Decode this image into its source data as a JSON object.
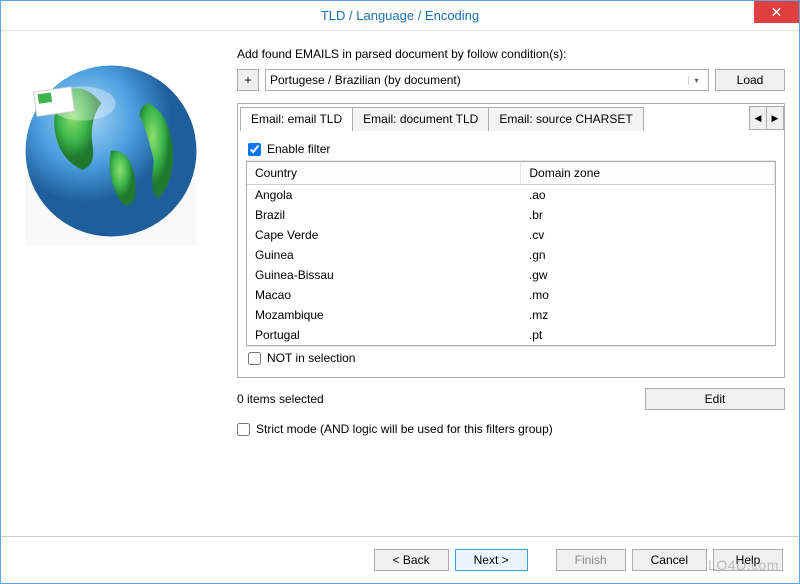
{
  "window": {
    "title": "TLD / Language / Encoding",
    "close": "✕"
  },
  "intro": "Add found EMAILS in parsed document by follow condition(s):",
  "dropdown": {
    "selected": "Portugese / Brazilian (by document)"
  },
  "buttons": {
    "plus": "+",
    "load": "Load",
    "edit": "Edit",
    "back": "< Back",
    "next": "Next >",
    "finish": "Finish",
    "cancel": "Cancel",
    "help": "Help"
  },
  "tabs": [
    {
      "label": "Email: email TLD",
      "active": true
    },
    {
      "label": "Email: document TLD",
      "active": false
    },
    {
      "label": "Email: source CHARSET",
      "active": false
    }
  ],
  "tab_arrows": {
    "left": "◀",
    "right": "▶"
  },
  "enable_filter": {
    "label": "Enable filter",
    "checked": true
  },
  "table": {
    "headers": {
      "country": "Country",
      "zone": "Domain zone"
    },
    "rows": [
      {
        "country": "Angola",
        "zone": ".ao"
      },
      {
        "country": "Brazil",
        "zone": ".br"
      },
      {
        "country": "Cape Verde",
        "zone": ".cv"
      },
      {
        "country": "Guinea",
        "zone": ".gn"
      },
      {
        "country": "Guinea-Bissau",
        "zone": ".gw"
      },
      {
        "country": "Macao",
        "zone": ".mo"
      },
      {
        "country": "Mozambique",
        "zone": ".mz"
      },
      {
        "country": "Portugal",
        "zone": ".pt"
      }
    ]
  },
  "not_in_selection": {
    "label": "NOT in selection",
    "checked": false
  },
  "status": "0 items selected",
  "strict_mode": {
    "label": "Strict mode (AND logic will be used for this filters group)",
    "checked": false
  },
  "watermark": "LO4D.com"
}
